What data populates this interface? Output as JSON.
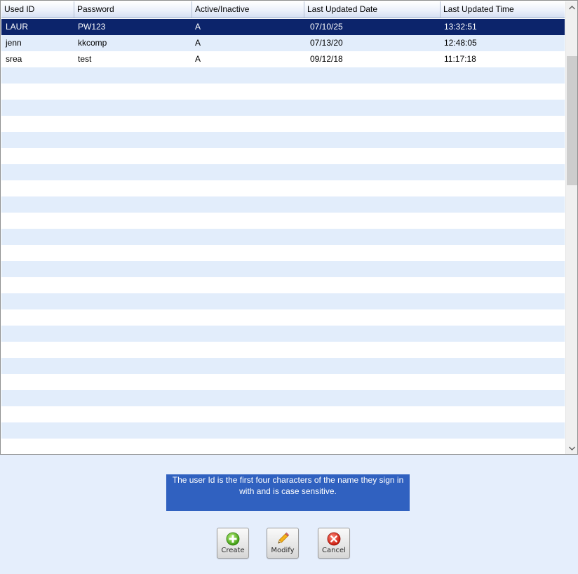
{
  "table": {
    "columns": [
      "Used ID",
      "Password",
      "Active/Inactive",
      "Last Updated Date",
      "Last Updated Time"
    ],
    "rows": [
      {
        "user_id": "LAUR",
        "password": "PW123",
        "status": "A",
        "date": "07/10/25",
        "time": "13:32:51",
        "selected": true
      },
      {
        "user_id": "jenn",
        "password": "kkcomp",
        "status": "A",
        "date": "07/13/20",
        "time": "12:48:05",
        "selected": false
      },
      {
        "user_id": "srea",
        "password": "test",
        "status": "A",
        "date": "09/12/18",
        "time": "11:17:18",
        "selected": false
      }
    ]
  },
  "info_text": "The user Id is the first four characters of the name they sign in with and is case sensitive.",
  "buttons": {
    "create_label": "Create",
    "modify_label": "Modify",
    "cancel_label": "Cancel"
  },
  "icons": {
    "create": "plus-circle-icon",
    "modify": "pencil-icon",
    "cancel": "x-circle-icon"
  },
  "colors": {
    "selected_row": "#0c246b",
    "alt_row": "#e2edfb",
    "info_box": "#3061c0",
    "background": "#e5eefc"
  }
}
